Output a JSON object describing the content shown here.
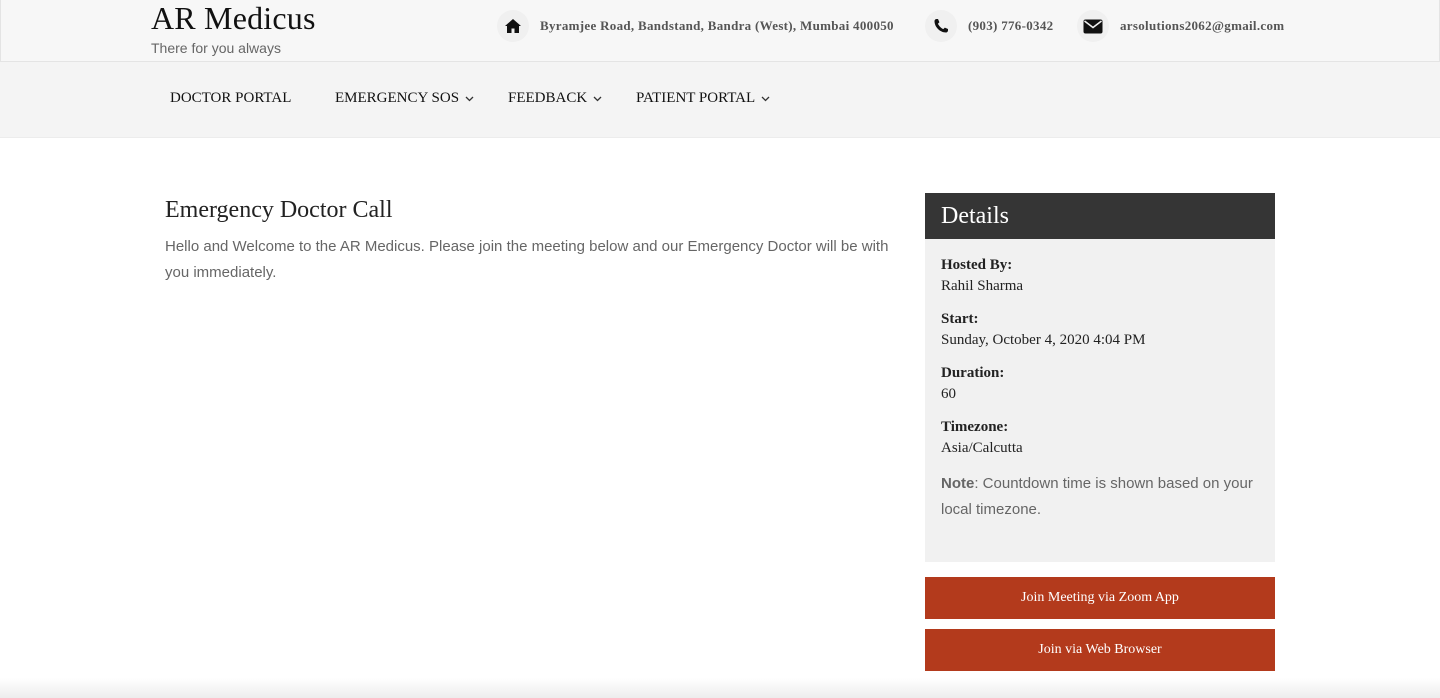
{
  "brand": {
    "title": "AR Medicus",
    "tagline": "There for you always"
  },
  "contact": {
    "address": {
      "icon": "home-icon",
      "text": "Byramjee Road, Bandstand, Bandra (West), Mumbai 400050"
    },
    "phone": {
      "icon": "phone-icon",
      "text": "(903) 776-0342"
    },
    "email": {
      "icon": "envelope-icon",
      "text": "arsolutions2062@gmail.com"
    }
  },
  "nav": {
    "items": [
      {
        "label": "DOCTOR PORTAL",
        "has_dropdown": false
      },
      {
        "label": "EMERGENCY SOS",
        "has_dropdown": true
      },
      {
        "label": "FEEDBACK",
        "has_dropdown": true
      },
      {
        "label": "PATIENT PORTAL",
        "has_dropdown": true
      }
    ]
  },
  "main": {
    "heading": "Emergency Doctor Call",
    "description": "Hello and Welcome to the AR Medicus. Please join the meeting below and our Emergency Doctor will be with you immediately."
  },
  "details": {
    "title": "Details",
    "fields": [
      {
        "label": "Hosted By:",
        "value": "Rahil Sharma"
      },
      {
        "label": "Start:",
        "value": "Sunday, October 4, 2020 4:04 PM"
      },
      {
        "label": "Duration:",
        "value": "60"
      },
      {
        "label": "Timezone:",
        "value": "Asia/Calcutta"
      }
    ],
    "note_label": "Note",
    "note_text": ": Countdown time is shown based on your local timezone."
  },
  "actions": {
    "zoom_app_label": "Join Meeting via Zoom App",
    "web_browser_label": "Join via Web Browser"
  },
  "colors": {
    "accent": "#b33a1c",
    "details_header": "#353535",
    "details_body": "#f1f1f1"
  }
}
